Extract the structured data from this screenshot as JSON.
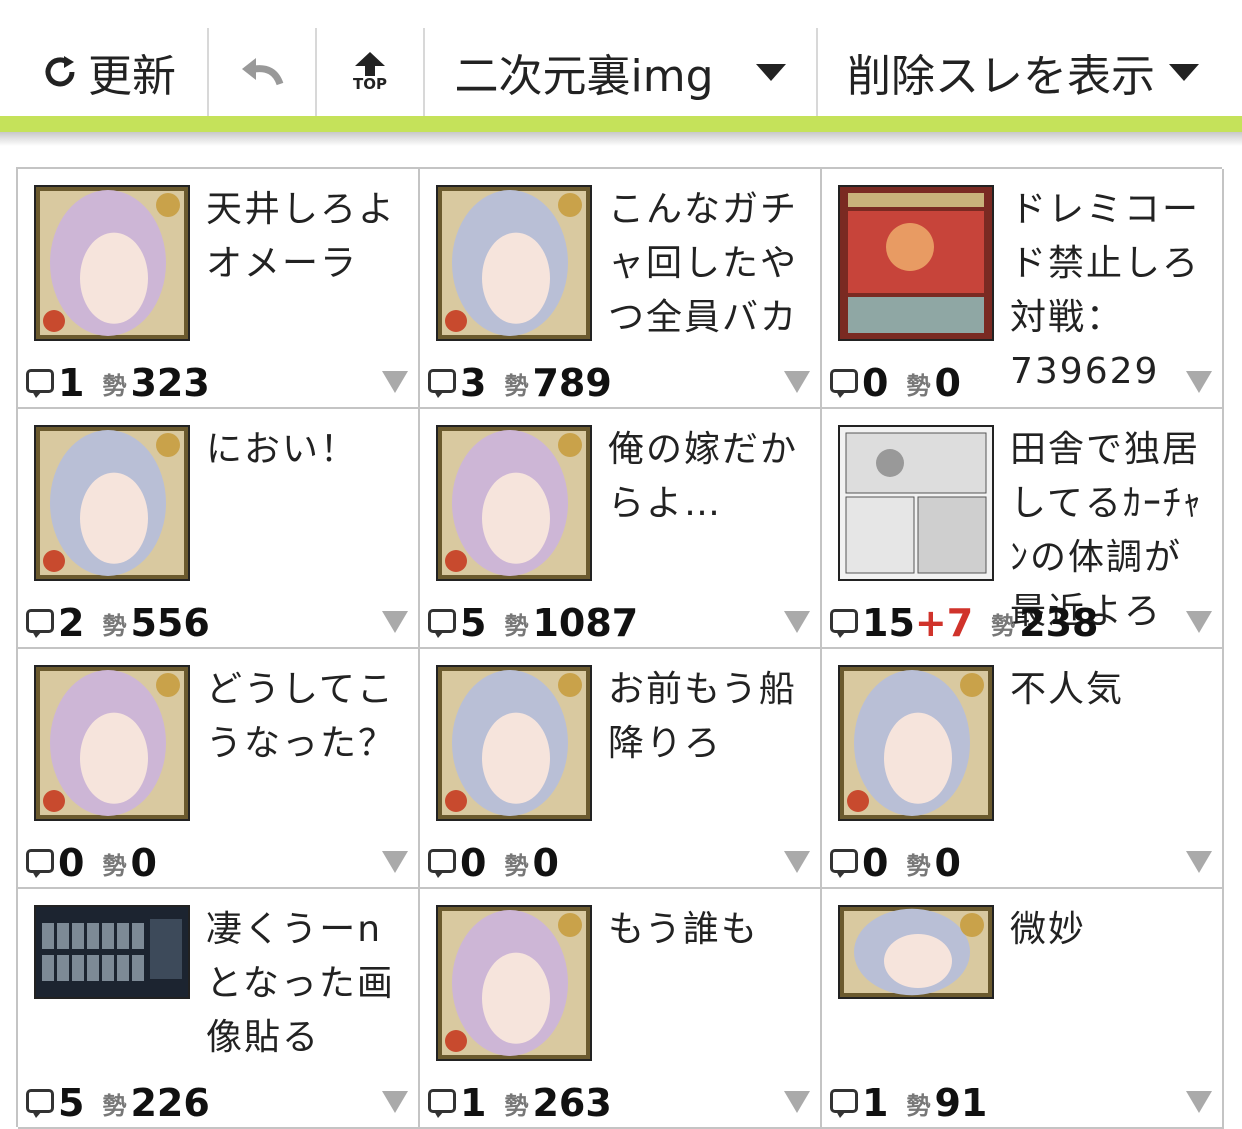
{
  "toolbar": {
    "refresh_icon": "refresh-icon",
    "refresh_label": "更新",
    "back_icon": "undo-arrow-icon",
    "top_icon": "scroll-top-icon",
    "top_label": "TOP",
    "board_label": "二次元裏img",
    "deleted_label": "削除スレを表示",
    "accent_color": "#c5e25a"
  },
  "threads": [
    {
      "title": "天井しろよオメーラ",
      "replies": "1",
      "new": "",
      "momentum": "323",
      "thumb": "anime-girl-lilac"
    },
    {
      "title": "こんなガチャ回したやつ全員バカ",
      "replies": "3",
      "new": "",
      "momentum": "789",
      "thumb": "anime-girl-silver"
    },
    {
      "title": "ドレミコード禁止しろ対戦：739629",
      "replies": "0",
      "new": "",
      "momentum": "0",
      "thumb": "trading-card"
    },
    {
      "title": "におい！",
      "replies": "2",
      "new": "",
      "momentum": "556",
      "thumb": "anime-girl-silver"
    },
    {
      "title": "俺の嫁だからよ…",
      "replies": "5",
      "new": "",
      "momentum": "1087",
      "thumb": "anime-girl-lilac"
    },
    {
      "title": "田舎で独居してるｶｰﾁｬﾝの体調が最近よろ",
      "replies": "15",
      "new": "+7",
      "momentum": "238",
      "thumb": "manga-page"
    },
    {
      "title": "どうしてこうなった？",
      "replies": "0",
      "new": "",
      "momentum": "0",
      "thumb": "anime-girl-lilac"
    },
    {
      "title": "お前もう船降りろ",
      "replies": "0",
      "new": "",
      "momentum": "0",
      "thumb": "anime-girl-silver"
    },
    {
      "title": "不人気",
      "replies": "0",
      "new": "",
      "momentum": "0",
      "thumb": "anime-girl-silver"
    },
    {
      "title": "凄くうーnとなった画像貼る",
      "replies": "5",
      "new": "",
      "momentum": "226",
      "thumb": "game-screenshot"
    },
    {
      "title": "もう誰も",
      "replies": "1",
      "new": "",
      "momentum": "263",
      "thumb": "anime-girl-lilac"
    },
    {
      "title": "微妙",
      "replies": "1",
      "new": "",
      "momentum": "91",
      "thumb": "anime-girl-banner"
    }
  ],
  "momentum_label": "勢"
}
